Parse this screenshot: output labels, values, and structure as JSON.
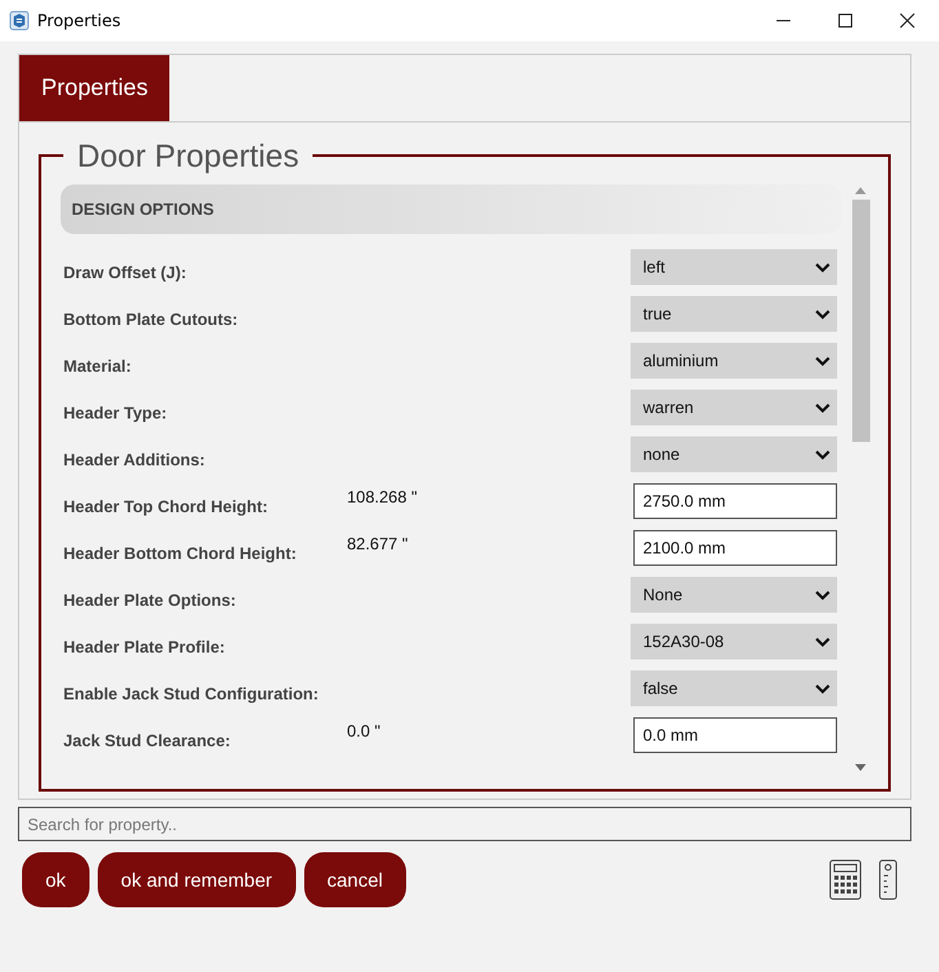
{
  "window": {
    "title": "Properties"
  },
  "tabs": [
    {
      "label": "Properties",
      "selected": true
    }
  ],
  "group": {
    "title": "Door Properties",
    "section": "DESIGN OPTIONS"
  },
  "rows": [
    {
      "kind": "select",
      "label": "Draw Offset (J):",
      "value": "left"
    },
    {
      "kind": "select",
      "label": "Bottom Plate Cutouts:",
      "value": "true"
    },
    {
      "kind": "select",
      "label": "Material:",
      "value": "aluminium"
    },
    {
      "kind": "select",
      "label": "Header Type:",
      "value": "warren"
    },
    {
      "kind": "select",
      "label": "Header Additions:",
      "value": "none"
    },
    {
      "kind": "input",
      "label": "Header Top Chord Height:",
      "reading": "108.268 \"",
      "value": "2750.0 mm"
    },
    {
      "kind": "input",
      "label": "Header Bottom Chord Height:",
      "reading": "82.677 \"",
      "value": "2100.0 mm"
    },
    {
      "kind": "select",
      "label": "Header Plate Options:",
      "value": "None"
    },
    {
      "kind": "select",
      "label": "Header Plate Profile:",
      "value": "152A30-08"
    },
    {
      "kind": "select",
      "label": "Enable Jack Stud Configuration:",
      "value": "false"
    },
    {
      "kind": "input",
      "label": "Jack Stud Clearance:",
      "reading": "0.0 \"",
      "value": "0.0 mm"
    }
  ],
  "search": {
    "placeholder": "Search for property.."
  },
  "buttons": [
    "ok",
    "ok and remember",
    "cancel"
  ]
}
